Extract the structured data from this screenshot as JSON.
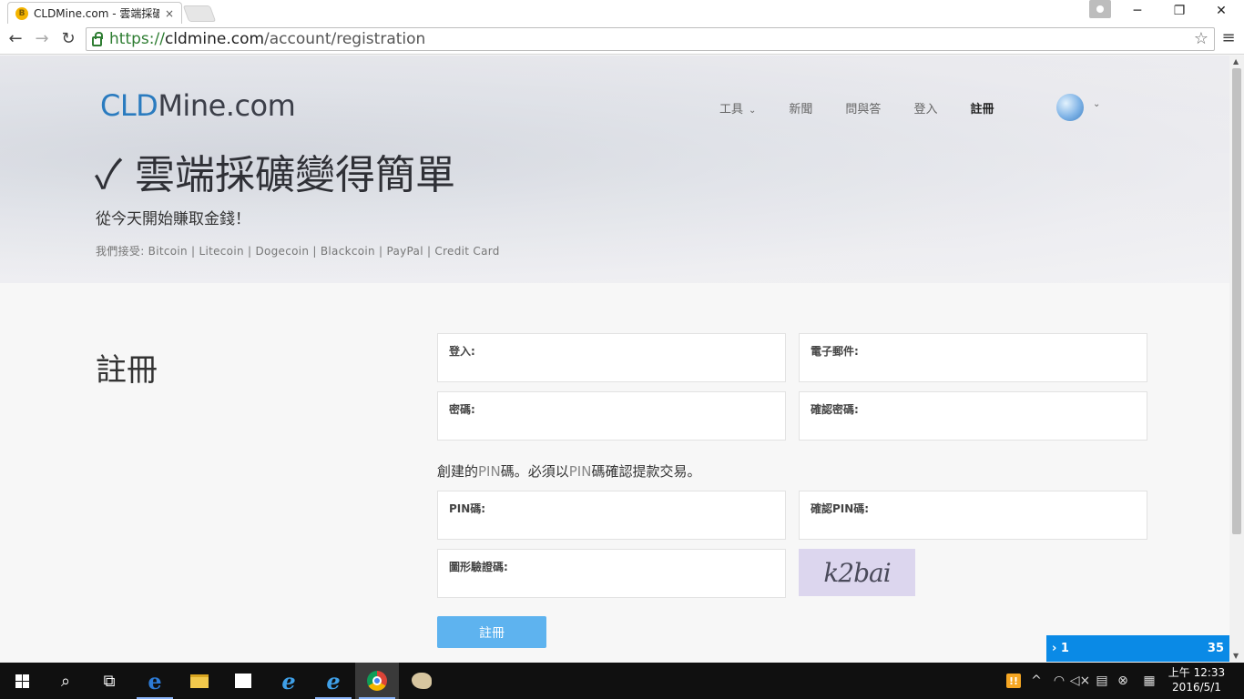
{
  "browser": {
    "tab_title": "CLDMine.com - 雲端採礦",
    "tab_close": "×",
    "url_scheme": "https://",
    "url_host": "cldmine.com",
    "url_path": "/account/registration",
    "window_controls": {
      "minimize": "─",
      "restore": "❐",
      "close": "✕"
    }
  },
  "site": {
    "logo_blue": "CLD",
    "logo_rest": "Mine.com",
    "nav": [
      {
        "label": "工具",
        "has_dropdown": true
      },
      {
        "label": "新聞"
      },
      {
        "label": "問與答"
      },
      {
        "label": "登入"
      },
      {
        "label": "註冊",
        "active": true
      }
    ],
    "headline": "✓ 雲端採礦變得簡單",
    "subhead": "從今天開始賺取金錢！",
    "accepts": "我們接受: Bitcoin | Litecoin | Dogecoin | Blackcoin | PayPal | Credit Card"
  },
  "form": {
    "section_title": "註冊",
    "fields": {
      "login": "登入:",
      "email": "電子郵件:",
      "password": "密碼:",
      "confirm_password": "確認密碼:",
      "pin": "PIN碼:",
      "confirm_pin": "確認PIN碼:",
      "captcha": "圖形驗證碼:"
    },
    "pin_note_1": "創建的",
    "pin_note_pin1": "PIN",
    "pin_note_2": "碼。必須以",
    "pin_note_pin2": "PIN",
    "pin_note_3": "碼確認提款交易。",
    "captcha_text": "k2bai",
    "submit_label": "註冊"
  },
  "notification": {
    "left": "› 1",
    "right": "35"
  },
  "taskbar": {
    "clock_time": "上午 12:33",
    "clock_date": "2016/5/1",
    "warn_badge": "!!"
  },
  "colors": {
    "accent_blue": "#2a7bbf",
    "submit_blue": "#5eb3ef",
    "notif_blue": "#0a8ae6"
  }
}
